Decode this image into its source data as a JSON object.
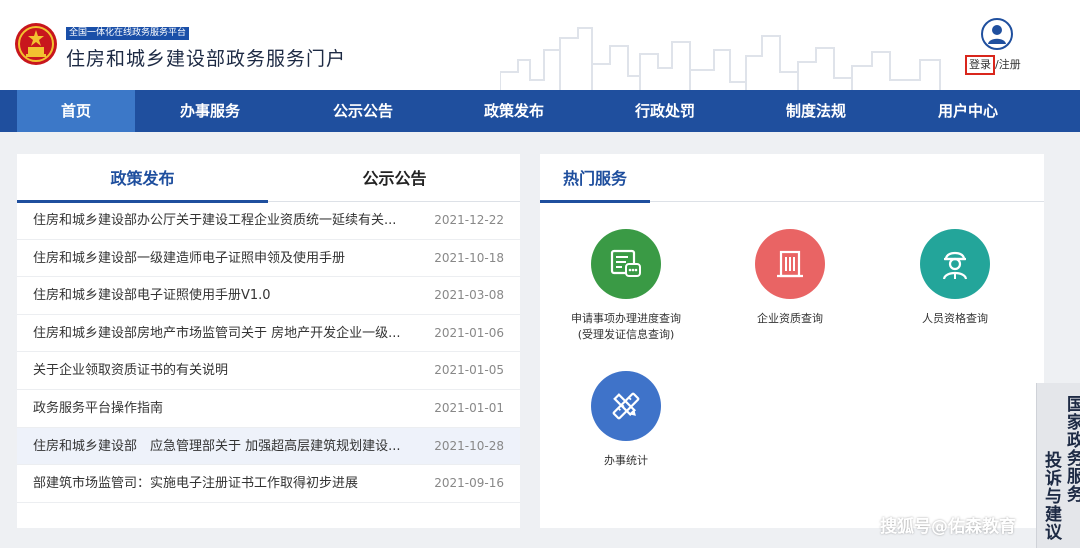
{
  "header": {
    "badge": "全国一体化在线政务服务平台",
    "title": "住房和城乡建设部政务服务门户",
    "login": "登录",
    "register": "/注册"
  },
  "nav": {
    "items": [
      {
        "label": "首页",
        "active": true
      },
      {
        "label": "办事服务"
      },
      {
        "label": "公示公告"
      },
      {
        "label": "政策发布"
      },
      {
        "label": "行政处罚"
      },
      {
        "label": "制度法规"
      },
      {
        "label": "用户中心"
      }
    ]
  },
  "news": {
    "tabs": [
      {
        "label": "政策发布",
        "active": true
      },
      {
        "label": "公示公告"
      }
    ],
    "items": [
      {
        "title": "住房和城乡建设部办公厅关于建设工程企业资质统一延续有关...",
        "date": "2021-12-22"
      },
      {
        "title": "住房和城乡建设部一级建造师电子证照申领及使用手册",
        "date": "2021-10-18"
      },
      {
        "title": "住房和城乡建设部电子证照使用手册V1.0",
        "date": "2021-03-08"
      },
      {
        "title": "住房和城乡建设部房地产市场监管司关于 房地产开发企业一级...",
        "date": "2021-01-06"
      },
      {
        "title": "关于企业领取资质证书的有关说明",
        "date": "2021-01-05"
      },
      {
        "title": "政务服务平台操作指南",
        "date": "2021-01-01"
      },
      {
        "title": "住房和城乡建设部　应急管理部关于 加强超高层建筑规划建设...",
        "date": "2021-10-28"
      },
      {
        "title": "部建筑市场监管司：实施电子注册证书工作取得初步进展",
        "date": "2021-09-16"
      }
    ]
  },
  "hot": {
    "title": "热门服务",
    "services": [
      {
        "line1": "申请事项办理进度查询",
        "line2": "(受理发证信息查询)",
        "icon": "progress-query-icon",
        "color": "#3a9a45"
      },
      {
        "line1": "企业资质查询",
        "line2": "",
        "icon": "building-icon",
        "color": "#e96464"
      },
      {
        "line1": "人员资格查询",
        "line2": "",
        "icon": "worker-icon",
        "color": "#23a59a"
      },
      {
        "line1": "办事统计",
        "line2": "",
        "icon": "ruler-pencil-icon",
        "color": "#3f73c9"
      }
    ]
  },
  "side": {
    "col1": "国家政务服务",
    "col2": "投诉与建议"
  },
  "watermark": "搜狐号@佑森教育"
}
